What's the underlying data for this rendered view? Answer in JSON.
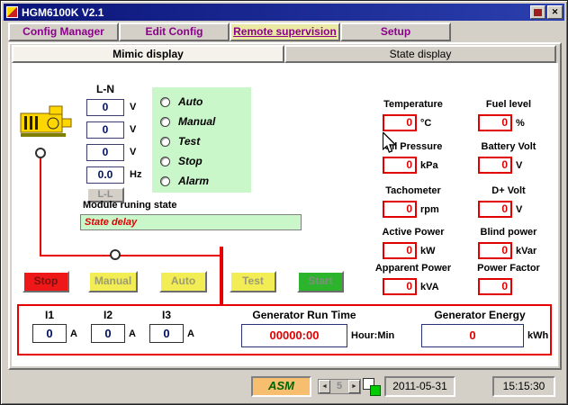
{
  "window": {
    "title": "HGM6100K V2.1"
  },
  "icons": {
    "close": "✕",
    "spinner_left": "◄",
    "spinner_right": "►"
  },
  "tabs": [
    {
      "label": "Config Manager"
    },
    {
      "label": "Edit Config"
    },
    {
      "label": "Remote supervision"
    },
    {
      "label": "Setup"
    }
  ],
  "subtabs": [
    {
      "label": "Mimic display"
    },
    {
      "label": "State display"
    }
  ],
  "voltage_panel": {
    "header": "L-N",
    "rows": [
      {
        "value": "0",
        "unit": "V"
      },
      {
        "value": "0",
        "unit": "V"
      },
      {
        "value": "0",
        "unit": "V"
      },
      {
        "value": "0.0",
        "unit": "Hz"
      }
    ],
    "ll_button": "L-L"
  },
  "run_states": [
    "Auto",
    "Manual",
    "Test",
    "Stop",
    "Alarm"
  ],
  "module_state": {
    "label": "Module runing state",
    "value": "State delay"
  },
  "readouts": [
    {
      "label": "Temperature",
      "value": "0",
      "unit": "°C"
    },
    {
      "label": "Oil Pressure",
      "value": "0",
      "unit": "kPa"
    },
    {
      "label": "Tachometer",
      "value": "0",
      "unit": "rpm"
    },
    {
      "label": "Active Power",
      "value": "0",
      "unit": "kW"
    },
    {
      "label": "Apparent Power",
      "value": "0",
      "unit": "kVA"
    },
    {
      "label": "Fuel level",
      "value": "0",
      "unit": "%"
    },
    {
      "label": "Battery Volt",
      "value": "0",
      "unit": "V"
    },
    {
      "label": "D+ Volt",
      "value": "0",
      "unit": "V"
    },
    {
      "label": "Blind power",
      "value": "0",
      "unit": "kVar"
    },
    {
      "label": "Power Factor",
      "value": "0",
      "unit": ""
    }
  ],
  "control_buttons": [
    {
      "label": "Stop"
    },
    {
      "label": "Manual"
    },
    {
      "label": "Auto"
    },
    {
      "label": "Test"
    },
    {
      "label": "Start"
    }
  ],
  "current_panel": {
    "phases": [
      {
        "label": "I1",
        "value": "0",
        "unit": "A"
      },
      {
        "label": "I2",
        "value": "0",
        "unit": "A"
      },
      {
        "label": "I3",
        "value": "0",
        "unit": "A"
      }
    ],
    "run_time": {
      "label": "Generator Run Time",
      "value": "00000:00",
      "unit": "Hour:Min"
    },
    "energy": {
      "label": "Generator Energy",
      "value": "0",
      "unit": "kWh"
    }
  },
  "status_bar": {
    "asm_label": "ASM",
    "spinner_value": "5",
    "date": "2011-05-31",
    "time": "15:15:30"
  }
}
